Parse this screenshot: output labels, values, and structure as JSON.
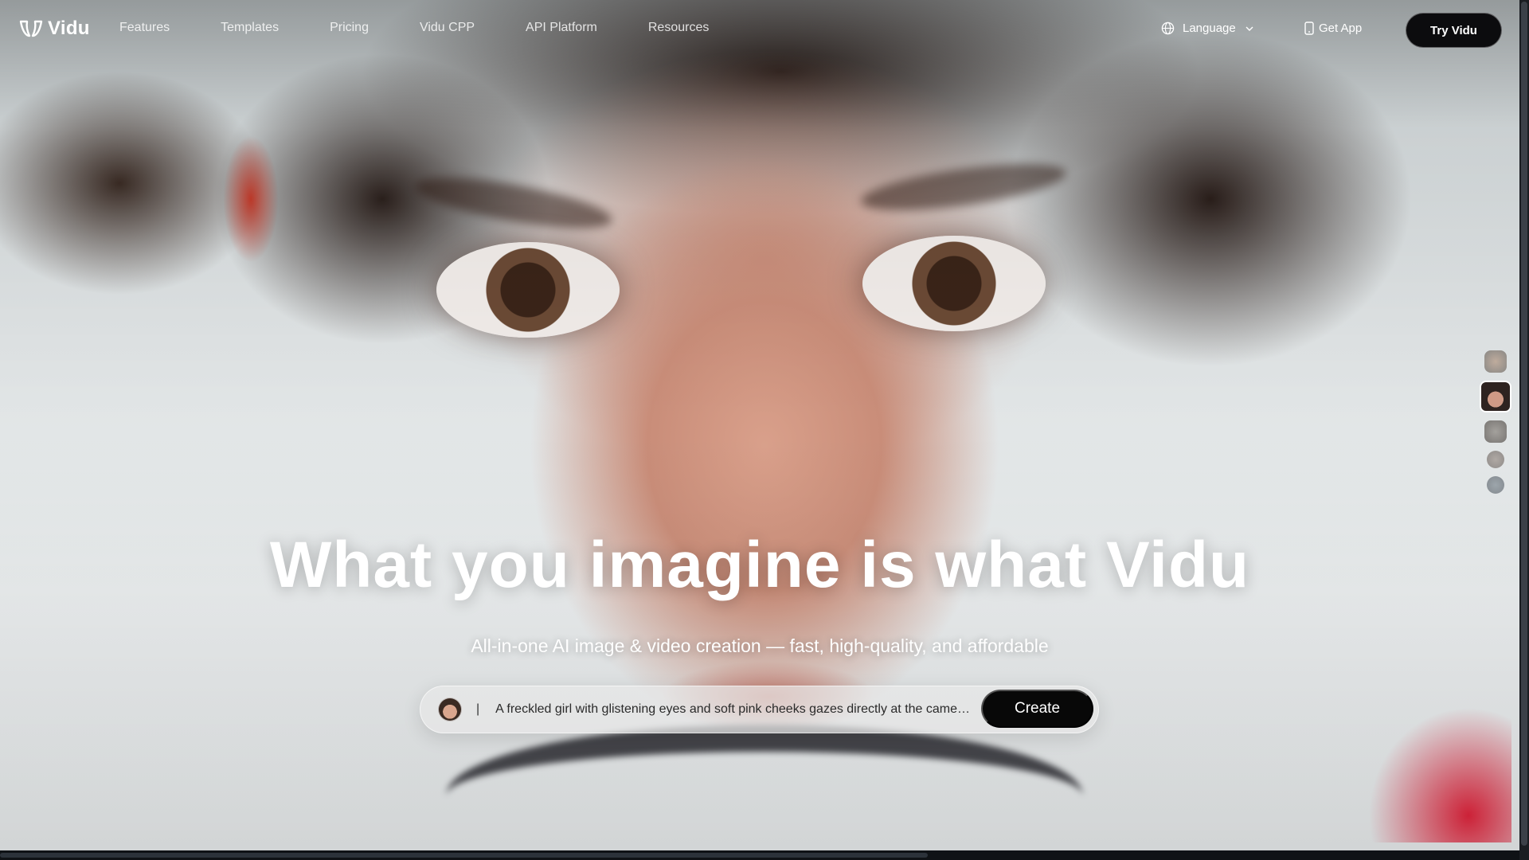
{
  "brand": {
    "name": "Vidu",
    "logo_icon": "vidu-logo-icon"
  },
  "nav": {
    "links": [
      {
        "label": "Features"
      },
      {
        "label": "Templates"
      },
      {
        "label": "Pricing"
      },
      {
        "label": "Vidu CPP"
      },
      {
        "label": "API Platform"
      },
      {
        "label": "Resources"
      }
    ],
    "language_label": "Language",
    "language_icon": "globe-icon",
    "get_app_label": "Get App",
    "get_app_icon": "phone-icon",
    "try_button_label": "Try Vidu"
  },
  "hero": {
    "headline": "What you imagine is what Vidu",
    "subheadline": "All-in-one AI image & video creation — fast, high-quality, and affordable",
    "prompt": {
      "separator": "|",
      "text": "A freckled girl with glistening eyes and soft pink cheeks gazes directly at the came…",
      "create_label": "Create"
    }
  },
  "colors": {
    "button_dark": "#080808",
    "text_light": "#ffffff",
    "prompt_bg": "#e8e8e8"
  }
}
